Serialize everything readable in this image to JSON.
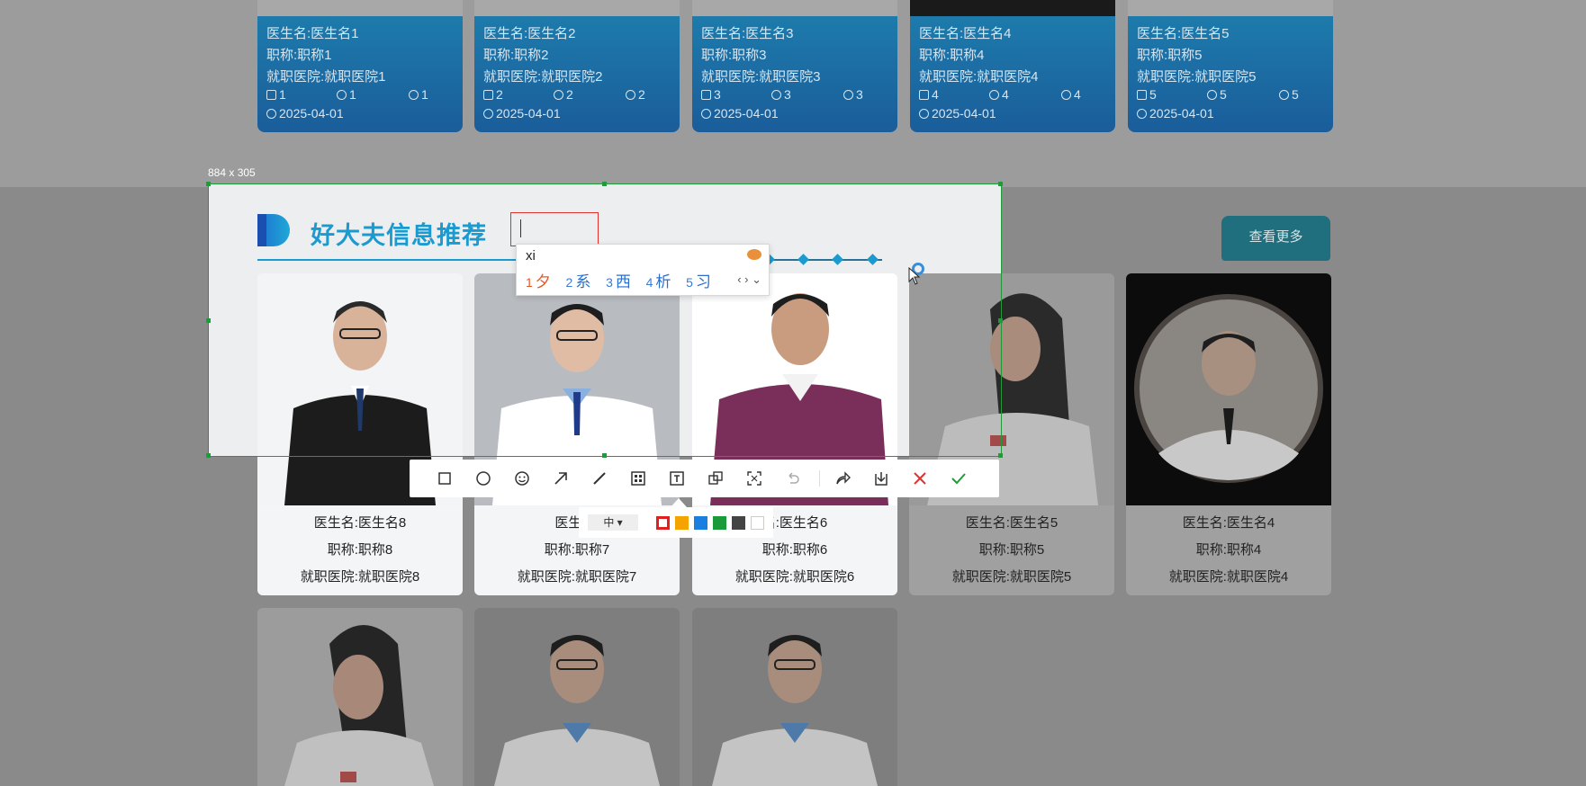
{
  "top_cards": [
    {
      "name": "医生名:医生名1",
      "title": "职称:职称1",
      "hospital": "就职医院:就职医院1",
      "likes": "1",
      "favorites": "1",
      "views": "1",
      "date": "2025-04-01"
    },
    {
      "name": "医生名:医生名2",
      "title": "职称:职称2",
      "hospital": "就职医院:就职医院2",
      "likes": "2",
      "favorites": "2",
      "views": "2",
      "date": "2025-04-01"
    },
    {
      "name": "医生名:医生名3",
      "title": "职称:职称3",
      "hospital": "就职医院:就职医院3",
      "likes": "3",
      "favorites": "3",
      "views": "3",
      "date": "2025-04-01"
    },
    {
      "name": "医生名:医生名4",
      "title": "职称:职称4",
      "hospital": "就职医院:就职医院4",
      "likes": "4",
      "favorites": "4",
      "views": "4",
      "date": "2025-04-01"
    },
    {
      "name": "医生名:医生名5",
      "title": "职称:职称5",
      "hospital": "就职医院:就职医院5",
      "likes": "5",
      "favorites": "5",
      "views": "5",
      "date": "2025-04-01"
    }
  ],
  "selection": {
    "size_label": "884 x 305"
  },
  "section": {
    "title": "好大夫信息推荐",
    "view_more": "查看更多"
  },
  "doctor_cards": [
    {
      "name": "医生名:医生名8",
      "title": "职称:职称8",
      "hospital": "就职医院:就职医院8"
    },
    {
      "name": "医生名:",
      "title": "职称:职称7",
      "hospital": "就职医院:就职医院7"
    },
    {
      "name": "名:医生名6",
      "title": "职称:职称6",
      "hospital": "就职医院:就职医院6"
    },
    {
      "name": "医生名:医生名5",
      "title": "职称:职称5",
      "hospital": "就职医院:就职医院5"
    },
    {
      "name": "医生名:医生名4",
      "title": "职称:职称4",
      "hospital": "就职医院:就职医院4"
    }
  ],
  "ime": {
    "input": "xi",
    "candidates": [
      {
        "num": "1",
        "word": "夕"
      },
      {
        "num": "2",
        "word": "系"
      },
      {
        "num": "3",
        "word": "西"
      },
      {
        "num": "4",
        "word": "析"
      },
      {
        "num": "5",
        "word": "习"
      }
    ],
    "nav": "‹ › ⌄"
  },
  "toolbar": {
    "tools": [
      "rectangle-tool",
      "ellipse-tool",
      "emoji-tool",
      "arrow-tool",
      "line-tool",
      "mosaic-tool",
      "text-tool",
      "pin-tool",
      "ocr-tool",
      "undo-tool",
      "share-tool",
      "download-tool",
      "cancel-tool",
      "confirm-tool"
    ],
    "size_option": "中",
    "colors": [
      "#e02020",
      "#f5a300",
      "#1a7fe0",
      "#1a9a3a",
      "#444444",
      "#ffffff"
    ]
  }
}
